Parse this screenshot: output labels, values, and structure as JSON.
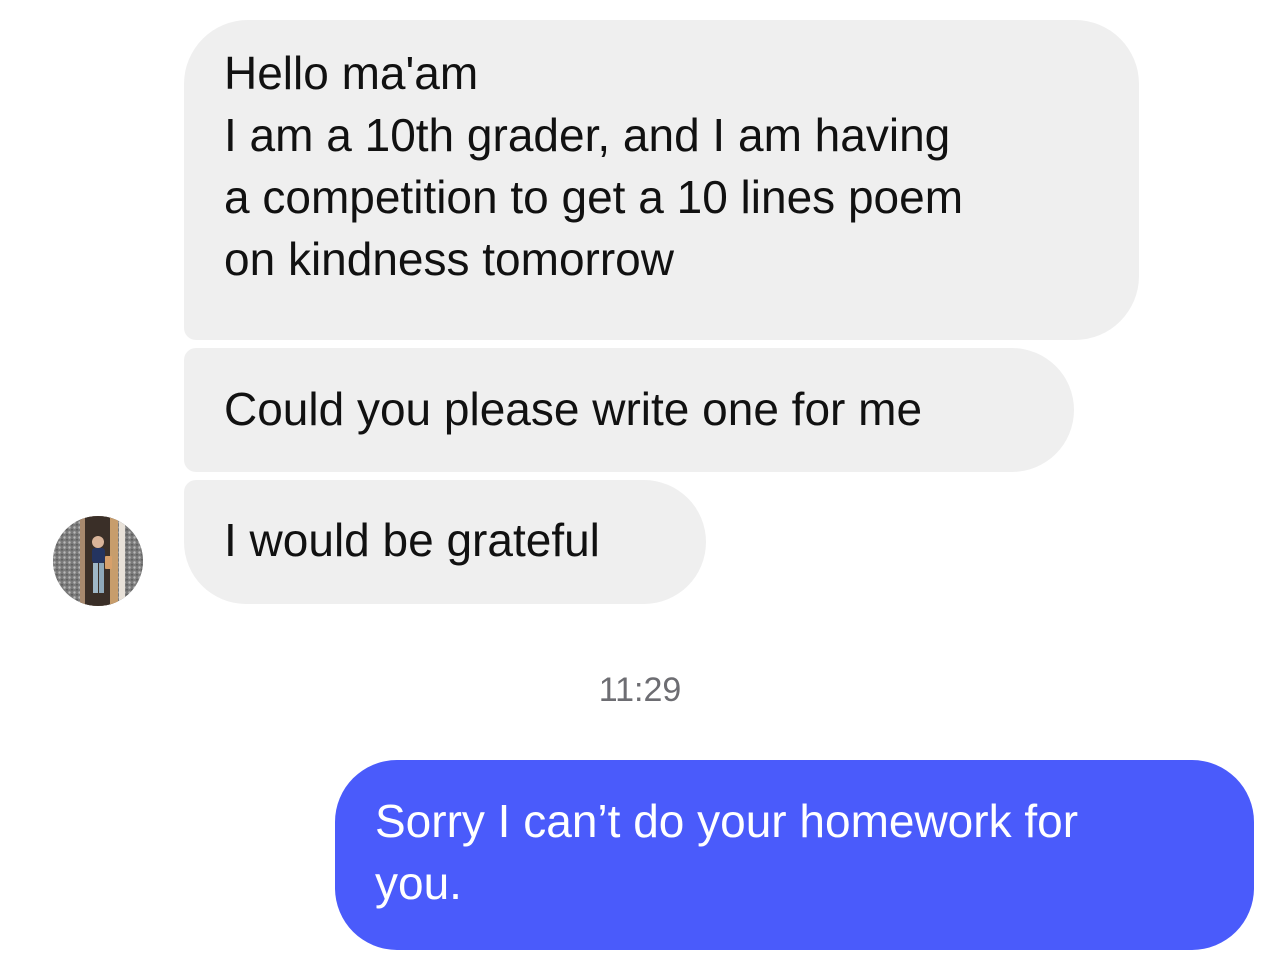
{
  "conversation": {
    "incoming_messages": [
      {
        "lines": [
          "Hello ma'am",
          "I am a 10th grader, and I am having",
          "a competition to get a 10 lines poem",
          "on kindness tomorrow"
        ]
      },
      {
        "lines": [
          "Could you please write one for me"
        ]
      },
      {
        "lines": [
          "I would be grateful"
        ]
      }
    ],
    "timestamp": "11:29",
    "outgoing_messages": [
      {
        "lines": [
          "Sorry I can’t do your homework for",
          "you."
        ]
      }
    ],
    "contact_avatar_icon": "avatar-photo-icon"
  },
  "colors": {
    "incoming_bubble": "#efefef",
    "outgoing_bubble": "#4a5bfb",
    "timestamp_text": "#6d6d72",
    "message_text": "#111111"
  }
}
